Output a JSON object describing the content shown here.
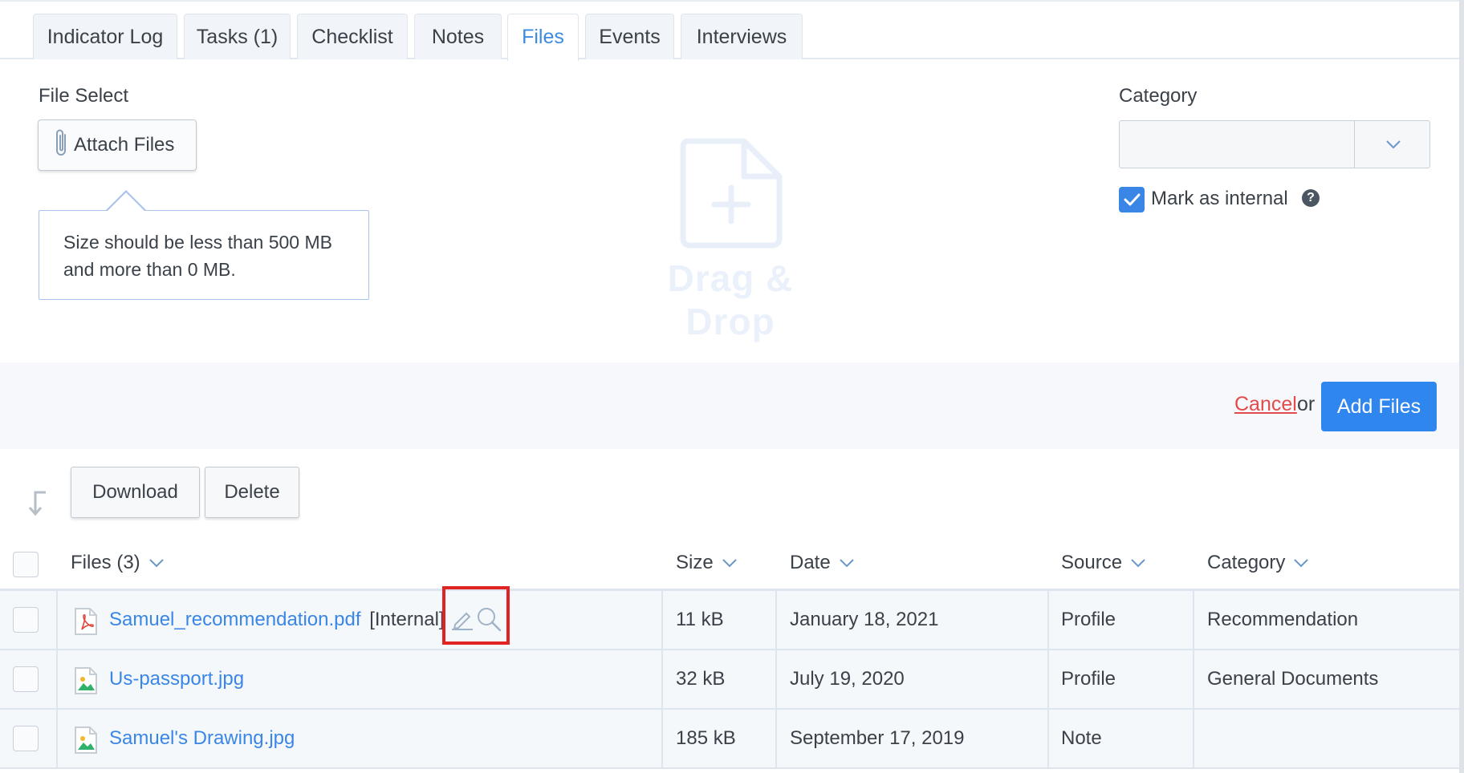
{
  "tabs": [
    {
      "label": "Indicator Log"
    },
    {
      "label": "Tasks (1)"
    },
    {
      "label": "Checklist"
    },
    {
      "label": "Notes"
    },
    {
      "label": "Files",
      "active": true
    },
    {
      "label": "Events"
    },
    {
      "label": "Interviews"
    }
  ],
  "upload": {
    "file_select_label": "File Select",
    "attach_button": "Attach Files",
    "tooltip_line1": "Size should be less than 500 MB",
    "tooltip_line2": "and more than 0 MB.",
    "dropzone_text": "Drag & Drop",
    "category_label": "Category",
    "category_value": "",
    "mark_internal_label": "Mark as internal",
    "mark_internal_checked": true,
    "help_glyph": "?"
  },
  "actions": {
    "cancel_label": "Cancel",
    "or_text": "or",
    "add_files_label": "Add Files"
  },
  "toolbar": {
    "download_label": "Download",
    "delete_label": "Delete"
  },
  "table": {
    "headers": {
      "files": "Files (3)",
      "size": "Size",
      "date": "Date",
      "source": "Source",
      "category": "Category"
    },
    "rows": [
      {
        "name": "Samuel_recommendation.pdf",
        "tag": "[Internal]",
        "icon": "pdf-file-icon",
        "size": "11 kB",
        "date": "January 18, 2021",
        "source": "Profile",
        "category": "Recommendation"
      },
      {
        "name": "Us-passport.jpg",
        "tag": "",
        "icon": "image-file-icon",
        "size": "32 kB",
        "date": "July 19, 2020",
        "source": "Profile",
        "category": "General Documents"
      },
      {
        "name": "Samuel's Drawing.jpg",
        "tag": "",
        "icon": "image-file-icon",
        "size": "185 kB",
        "date": "September 17, 2019",
        "source": "Note",
        "category": ""
      }
    ]
  },
  "colors": {
    "accent": "#3a86e6",
    "primary_button": "#2f86ee",
    "cancel": "#e24b4b",
    "highlight": "#e02424"
  }
}
